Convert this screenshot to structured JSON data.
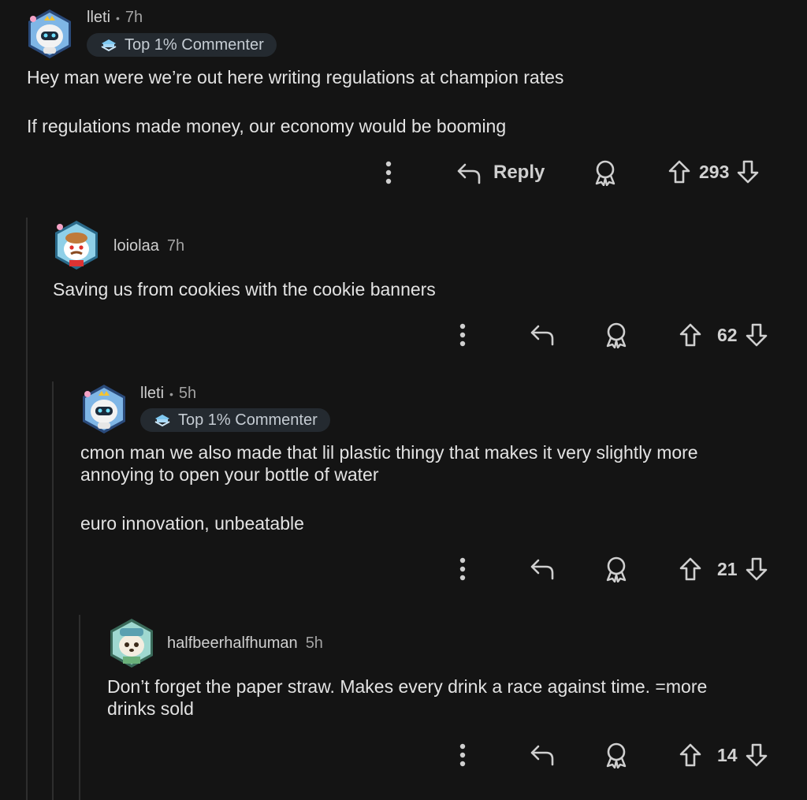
{
  "comments": [
    {
      "author": "lleti",
      "time": "7h",
      "flair": "Top 1% Commenter",
      "paragraphs": [
        "Hey man were we’re out here writing regulations at champion rates",
        "If regulations made money, our economy would be booming"
      ],
      "score": "293",
      "reply_label": "Reply"
    },
    {
      "author": "loiolaa",
      "time": "7h",
      "paragraphs": [
        "Saving us from cookies with the cookie banners"
      ],
      "score": "62"
    },
    {
      "author": "lleti",
      "time": "5h",
      "flair": "Top 1% Commenter",
      "paragraphs": [
        "cmon man we also made that lil plastic thingy that makes it very slightly more\nannoying to open your bottle of water",
        "euro innovation, unbeatable"
      ],
      "score": "21"
    },
    {
      "author": "halfbeerhalfhuman",
      "time": "5h",
      "paragraphs": [
        "Don’t forget the paper straw. Makes every drink a race against time. =more\ndrinks sold"
      ],
      "score": "14"
    }
  ],
  "icons": {
    "more": "vertical-dots-icon",
    "reply": "reply-arrow-icon",
    "award": "award-icon",
    "upvote": "upvote-arrow-icon",
    "downvote": "downvote-arrow-icon"
  },
  "colors": {
    "background": "#141414",
    "text": "#e3e3e3",
    "muted": "#a9a9a9",
    "flair_bg": "#242a30",
    "thread_line": "#2e2e2e"
  }
}
